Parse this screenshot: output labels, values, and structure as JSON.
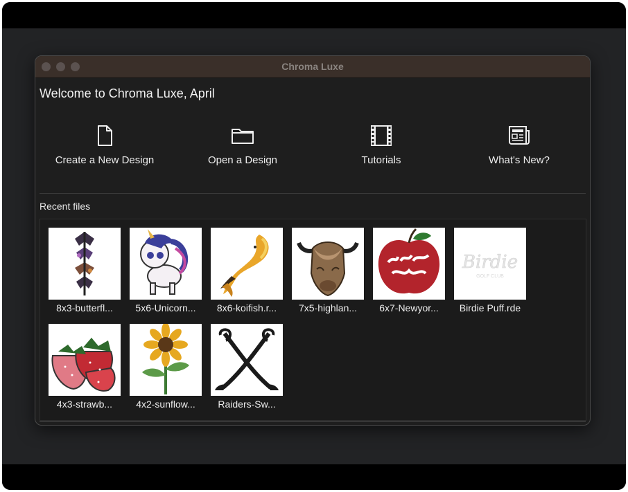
{
  "window": {
    "title": "Chroma Luxe"
  },
  "welcome": {
    "text": "Welcome to Chroma Luxe, April"
  },
  "actions": [
    {
      "label": "Create a New Design",
      "icon": "new-document-icon"
    },
    {
      "label": "Open a Design",
      "icon": "folder-icon"
    },
    {
      "label": "Tutorials",
      "icon": "film-strip-icon"
    },
    {
      "label": "What's New?",
      "icon": "newspaper-icon"
    }
  ],
  "recent": {
    "heading": "Recent files",
    "files": [
      {
        "name": "8x3-butterfl...",
        "thumb": "butterflies-thumbnail"
      },
      {
        "name": "5x6-Unicorn...",
        "thumb": "unicorn-thumbnail"
      },
      {
        "name": "8x6-koifish.r...",
        "thumb": "koi-fish-thumbnail"
      },
      {
        "name": "7x5-highlan...",
        "thumb": "highland-cow-thumbnail"
      },
      {
        "name": "6x7-Newyor...",
        "thumb": "new-york-apple-thumbnail"
      },
      {
        "name": "Birdie Puff.rde",
        "thumb": "birdie-logo-thumbnail",
        "logo_text": "Birdie",
        "logo_sub": "GOLF CLUB"
      },
      {
        "name": "4x3-strawb...",
        "thumb": "strawberries-thumbnail"
      },
      {
        "name": "4x2-sunflow...",
        "thumb": "sunflower-thumbnail"
      },
      {
        "name": "Raiders-Sw...",
        "thumb": "crossed-swords-thumbnail"
      }
    ]
  },
  "colors": {
    "titlebar": "#3a2f29",
    "window_bg": "#1e1e1e",
    "text": "#ececec"
  }
}
